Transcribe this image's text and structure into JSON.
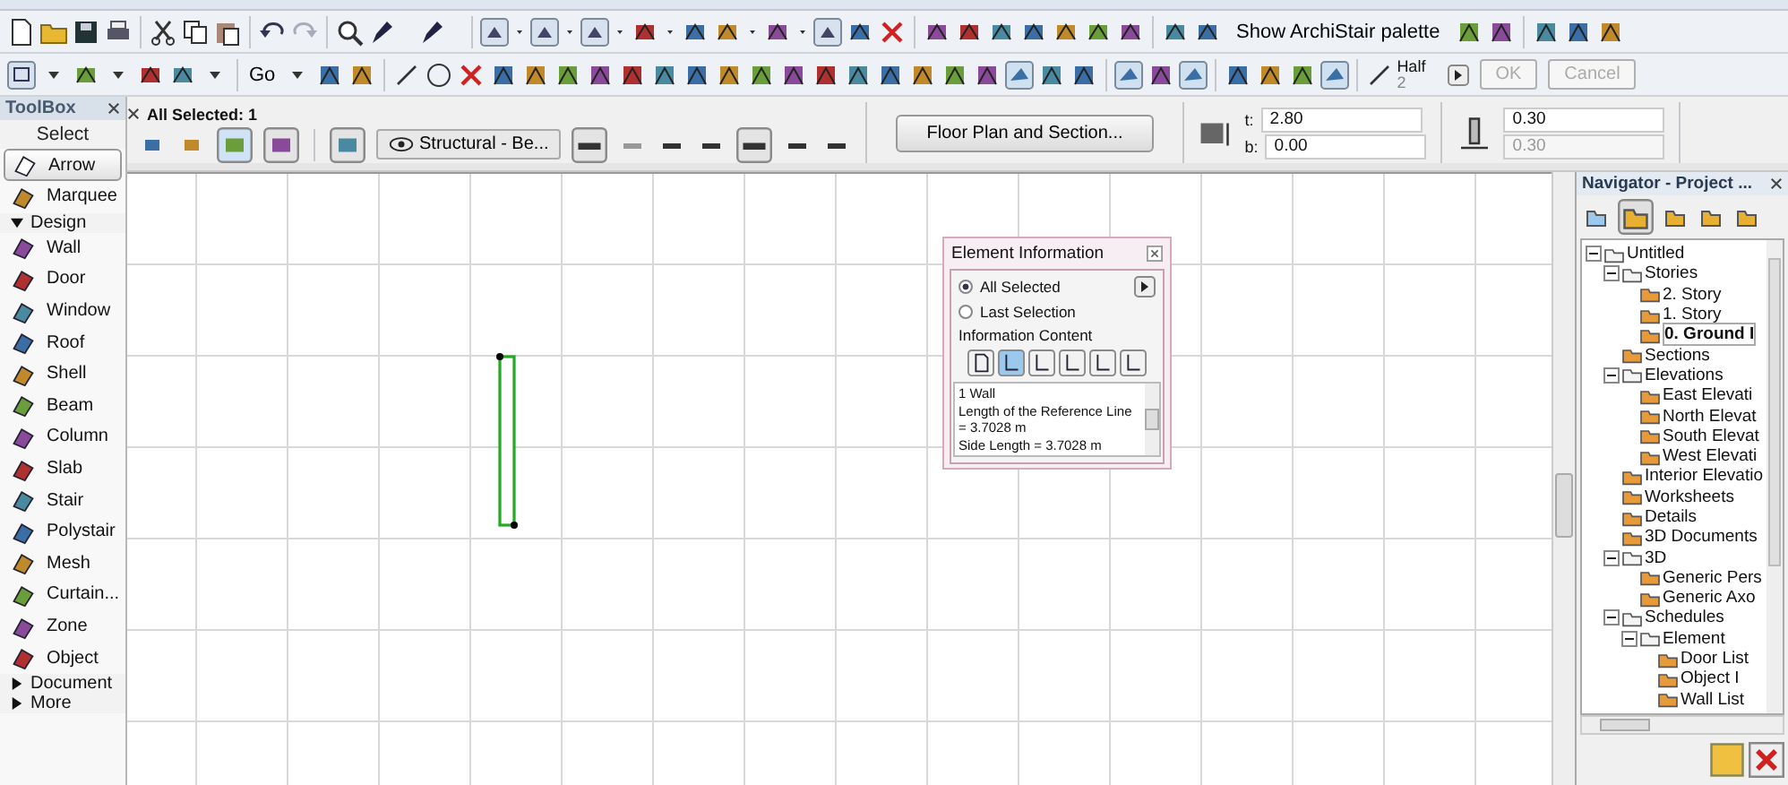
{
  "toolbar_top": {
    "palette_button": "Show ArchiStair palette"
  },
  "toolbar_standard": {
    "go_button": "Go",
    "pen_label": "Half",
    "pen_number": "2",
    "buttons": [
      {
        "label": "OK",
        "disabled": true
      },
      {
        "label": "Cancel",
        "disabled": true
      }
    ]
  },
  "info_box": {
    "title": "All Selected: 1",
    "layer": "Structural - Be...",
    "settings_button": "Floor Plan and Section...",
    "top_label": "t:",
    "top_value": "2.80",
    "bottom_label": "b:",
    "bottom_value": "0.00",
    "thickness": {
      "value": "0.30",
      "disabled": false
    },
    "thickness_2": {
      "value": "0.30",
      "disabled": true
    }
  },
  "toolbox": {
    "title": "ToolBox",
    "subtitle": "Select",
    "items": [
      {
        "kind": "tool",
        "label": "Arrow",
        "selected": true
      },
      {
        "kind": "tool",
        "label": "Marquee",
        "selected": false
      },
      {
        "kind": "section",
        "label": "Design",
        "expanded": true
      },
      {
        "kind": "tool",
        "label": "Wall",
        "selected": false
      },
      {
        "kind": "tool",
        "label": "Door",
        "selected": false
      },
      {
        "kind": "tool",
        "label": "Window",
        "selected": false
      },
      {
        "kind": "tool",
        "label": "Roof",
        "selected": false
      },
      {
        "kind": "tool",
        "label": "Shell",
        "selected": false
      },
      {
        "kind": "tool",
        "label": "Beam",
        "selected": false
      },
      {
        "kind": "tool",
        "label": "Column",
        "selected": false
      },
      {
        "kind": "tool",
        "label": "Slab",
        "selected": false
      },
      {
        "kind": "tool",
        "label": "Stair",
        "selected": false
      },
      {
        "kind": "tool",
        "label": "Polystair",
        "selected": false
      },
      {
        "kind": "tool",
        "label": "Mesh",
        "selected": false
      },
      {
        "kind": "tool",
        "label": "Curtain...",
        "selected": false
      },
      {
        "kind": "tool",
        "label": "Zone",
        "selected": false
      },
      {
        "kind": "tool",
        "label": "Object",
        "selected": false
      },
      {
        "kind": "section",
        "label": "Document",
        "expanded": false
      },
      {
        "kind": "section",
        "label": "More",
        "expanded": false
      }
    ]
  },
  "element_information": {
    "title": "Element Information",
    "options": [
      {
        "label": "All Selected",
        "selected": true
      },
      {
        "label": "Last Selection",
        "selected": false
      }
    ],
    "content_label": "Information Content",
    "content_buttons": [
      {
        "selected": false
      },
      {
        "selected": true
      },
      {
        "selected": false
      },
      {
        "selected": false
      },
      {
        "selected": false
      },
      {
        "selected": false
      }
    ],
    "lines": [
      "1 Wall",
      "Length of the Reference Line",
      "= 3.7028 m",
      "Side Length = 3.7028 m"
    ]
  },
  "navigator": {
    "title": "Navigator - Project ...",
    "tree": [
      {
        "label": "Untitled",
        "selected": false,
        "expanded": true,
        "children": [
          {
            "label": "Stories",
            "selected": false,
            "expanded": true,
            "children": [
              {
                "label": "2. Story",
                "selected": false
              },
              {
                "label": "1. Story",
                "selected": false
              },
              {
                "label": "0. Ground I",
                "selected": true
              }
            ]
          },
          {
            "label": "Sections",
            "selected": false
          },
          {
            "label": "Elevations",
            "selected": false,
            "expanded": true,
            "children": [
              {
                "label": "East Elevati",
                "selected": false
              },
              {
                "label": "North Elevat",
                "selected": false
              },
              {
                "label": "South Elevat",
                "selected": false
              },
              {
                "label": "West Elevati",
                "selected": false
              }
            ]
          },
          {
            "label": "Interior Elevatio",
            "selected": false
          },
          {
            "label": "Worksheets",
            "selected": false
          },
          {
            "label": "Details",
            "selected": false
          },
          {
            "label": "3D Documents",
            "selected": false
          },
          {
            "label": "3D",
            "selected": false,
            "expanded": true,
            "children": [
              {
                "label": "Generic Pers",
                "selected": false
              },
              {
                "label": "Generic Axo",
                "selected": false
              }
            ]
          },
          {
            "label": "Schedules",
            "selected": false,
            "expanded": true,
            "children": [
              {
                "label": "Element",
                "selected": false,
                "expanded": true,
                "children": [
                  {
                    "label": "Door List",
                    "selected": false
                  },
                  {
                    "label": "Object I",
                    "selected": false
                  },
                  {
                    "label": "Wall List",
                    "selected": false
                  }
                ]
              }
            ]
          }
        ]
      }
    ]
  }
}
